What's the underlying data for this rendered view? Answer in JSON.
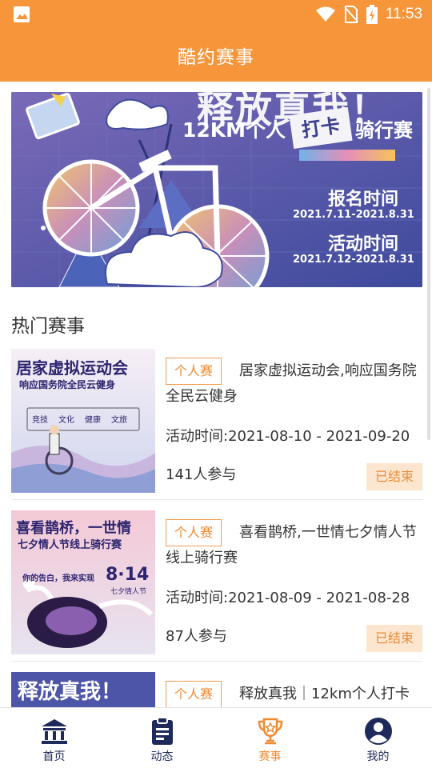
{
  "status_bar": {
    "time": "11:53"
  },
  "app_bar": {
    "title": "酷约赛事"
  },
  "banner": {
    "headline": "释放真我！",
    "subtitle_left": "12KM个人",
    "subtitle_punch": "打卡",
    "subtitle_right": "骑行赛",
    "signup_label": "报名时间",
    "signup_dates": "2021.7.11-2021.8.31",
    "activity_label": "活动时间",
    "activity_dates": "2021.7.12-2021.8.31"
  },
  "section": {
    "title": "热门赛事"
  },
  "events": [
    {
      "badge": "个人赛",
      "title": "居家虚拟运动会,响应国务院全民云健身",
      "time": "活动时间:2021-08-10 - 2021-09-20",
      "participants": "141人参与",
      "status": "已结束",
      "thumb": {
        "line1": "居家虚拟运动会",
        "line2": "响应国务院全民云健身",
        "tags": [
          "竞技",
          "文化",
          "健康",
          "文旅"
        ]
      }
    },
    {
      "badge": "个人赛",
      "title": "喜看鹊桥,一世情七夕情人节线上骑行赛",
      "time": "活动时间:2021-08-09 - 2021-08-28",
      "participants": "87人参与",
      "status": "已结束",
      "thumb": {
        "line1": "喜看鹊桥，一世情",
        "line2": "七夕情人节线上骑行赛",
        "slogan": "你的告白，我来实现",
        "date": "8·14",
        "date_sub": "七夕情人节"
      }
    },
    {
      "badge": "个人赛",
      "title": "释放真我｜12km个人打卡",
      "thumb": {
        "line1": "释放真我！"
      }
    }
  ],
  "tabbar": {
    "items": [
      {
        "label": "首页",
        "icon": "bank-icon"
      },
      {
        "label": "动态",
        "icon": "clipboard-icon"
      },
      {
        "label": "赛事",
        "icon": "trophy-icon"
      },
      {
        "label": "我的",
        "icon": "user-circle-icon"
      }
    ],
    "active_index": 2,
    "active_color": "#f08b34",
    "inactive_color": "#1e2a5a"
  },
  "colors": {
    "primary": "#f7953a",
    "badge_border": "#f29b4b",
    "status_bg": "#fde6cf"
  }
}
